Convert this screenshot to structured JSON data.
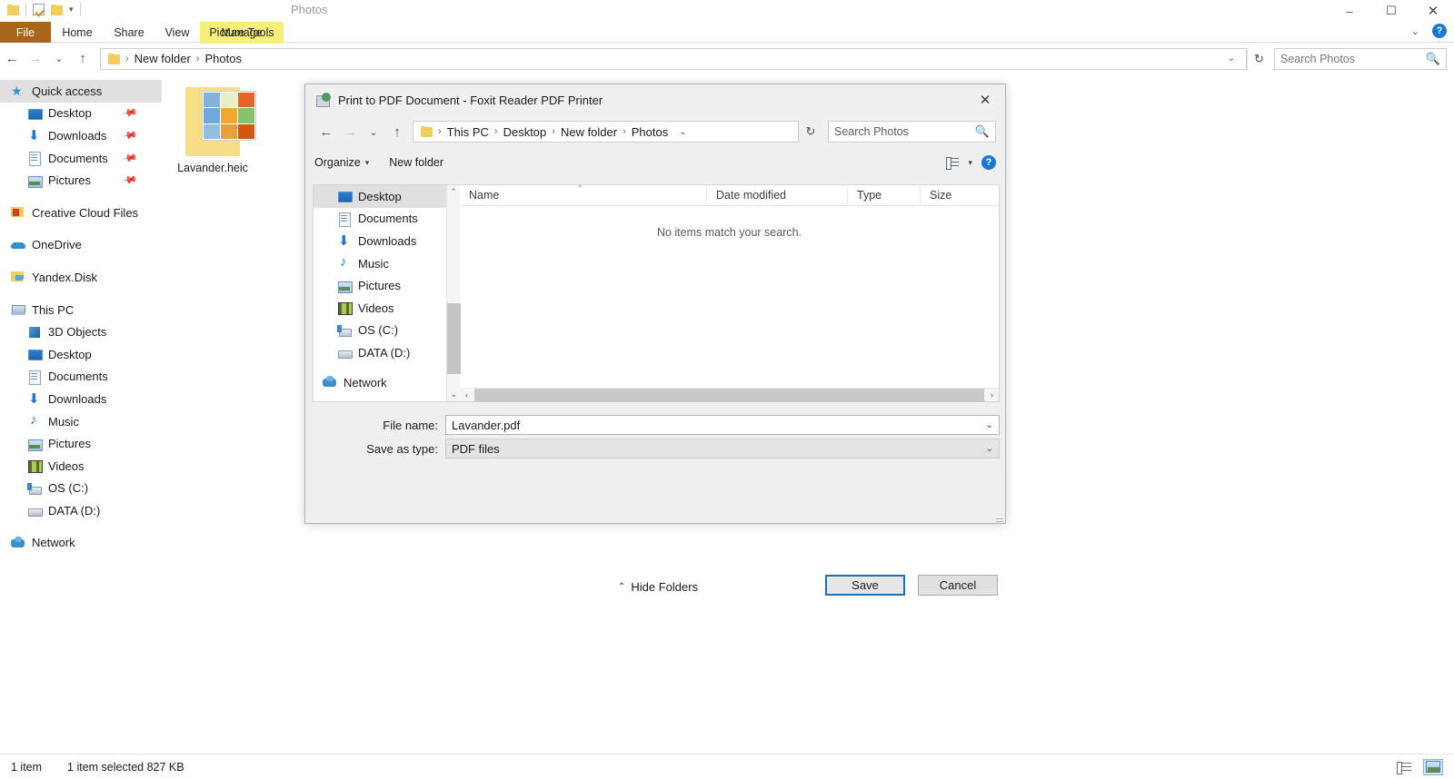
{
  "explorer": {
    "quick_access_toolbar": {
      "items": [
        "folder-icon",
        "checkbox-properties-icon",
        "folder-new-icon",
        "customize-caret-icon"
      ]
    },
    "window_controls": {
      "minimize": "–",
      "maximize": "❐",
      "close": "✕"
    },
    "ribbon": {
      "tabs": [
        "File",
        "Home",
        "Share",
        "View",
        "Picture Tools"
      ],
      "contextual_tab": "Manage",
      "app_label": "Photos",
      "collapse_caret": "⌄",
      "help_label": "?"
    },
    "address": {
      "back": "←",
      "forward": "→",
      "recent": "⌄",
      "up": "↑",
      "breadcrumbs": [
        "New folder",
        "Photos"
      ],
      "separator": "›",
      "dropdown_caret": "⌄",
      "refresh": "↻"
    },
    "search": {
      "placeholder": "Search Photos",
      "icon": "🔍"
    },
    "nav_pane": [
      {
        "label": "Quick access",
        "icon": "ic-star",
        "indent": "lvl0",
        "selected": true,
        "pinned": false
      },
      {
        "label": "Desktop",
        "icon": "ic-desktop",
        "indent": "lvl1",
        "selected": false,
        "pinned": true
      },
      {
        "label": "Downloads",
        "icon": "ic-download",
        "indent": "lvl1",
        "selected": false,
        "pinned": true
      },
      {
        "label": "Documents",
        "icon": "ic-doc",
        "indent": "lvl1",
        "selected": false,
        "pinned": true
      },
      {
        "label": "Pictures",
        "icon": "ic-pic",
        "indent": "lvl1",
        "selected": false,
        "pinned": true
      },
      {
        "label": "Creative Cloud Files",
        "icon": "ic-cc",
        "indent": "lvl0",
        "selected": false,
        "pinned": false
      },
      {
        "label": "OneDrive",
        "icon": "ic-cloud",
        "indent": "lvl0",
        "selected": false,
        "pinned": false
      },
      {
        "label": "Yandex.Disk",
        "icon": "ic-yandex",
        "indent": "lvl0",
        "selected": false,
        "pinned": false
      },
      {
        "label": "This PC",
        "icon": "ic-pc",
        "indent": "lvl0",
        "selected": false,
        "pinned": false
      },
      {
        "label": "3D Objects",
        "icon": "ic-3d",
        "indent": "lvl1",
        "selected": false,
        "pinned": false
      },
      {
        "label": "Desktop",
        "icon": "ic-desktop",
        "indent": "lvl1",
        "selected": false,
        "pinned": false
      },
      {
        "label": "Documents",
        "icon": "ic-doc",
        "indent": "lvl1",
        "selected": false,
        "pinned": false
      },
      {
        "label": "Downloads",
        "icon": "ic-download",
        "indent": "lvl1",
        "selected": false,
        "pinned": false
      },
      {
        "label": "Music",
        "icon": "ic-music",
        "indent": "lvl1",
        "selected": false,
        "pinned": false
      },
      {
        "label": "Pictures",
        "icon": "ic-pic",
        "indent": "lvl1",
        "selected": false,
        "pinned": false
      },
      {
        "label": "Videos",
        "icon": "ic-video",
        "indent": "lvl1",
        "selected": false,
        "pinned": false
      },
      {
        "label": "OS (C:)",
        "icon": "ic-osdrive",
        "indent": "lvl1",
        "selected": false,
        "pinned": false
      },
      {
        "label": "DATA (D:)",
        "icon": "ic-drive",
        "indent": "lvl1",
        "selected": false,
        "pinned": false
      },
      {
        "label": "Network",
        "icon": "ic-network",
        "indent": "lvl0",
        "selected": false,
        "pinned": false
      }
    ],
    "files": [
      {
        "name": "Lavander.heic",
        "thumb_colors": [
          "#7fb4d8",
          "#e8f0c8",
          "#e8632a",
          "#6fa8dc",
          "#f0a830",
          "#86c26a",
          "#8fc0e0",
          "#e8a03a",
          "#d4560f"
        ]
      }
    ],
    "status": {
      "count": "1 item",
      "selection": "1 item selected  827 KB"
    },
    "view_buttons": {
      "details": "details-view",
      "large_icons": "large-icons-view",
      "active": "large_icons"
    }
  },
  "dialog": {
    "title": "Print to PDF Document - Foxit Reader PDF Printer",
    "close": "✕",
    "nav": {
      "back": "←",
      "forward": "→",
      "recent": "⌄",
      "up": "↑",
      "breadcrumbs": [
        "This PC",
        "Desktop",
        "New folder",
        "Photos"
      ],
      "separator": "›",
      "dropdown_caret": "⌄",
      "refresh": "↻"
    },
    "search": {
      "placeholder": "Search Photos",
      "icon": "🔍"
    },
    "toolbar": {
      "organize": "Organize",
      "organize_caret": "▾",
      "new_folder": "New folder",
      "view_caret": "▾",
      "help_label": "?"
    },
    "tree": [
      {
        "label": "Desktop",
        "icon": "ic-desktop",
        "selected": true,
        "root": false
      },
      {
        "label": "Documents",
        "icon": "ic-doc",
        "selected": false,
        "root": false
      },
      {
        "label": "Downloads",
        "icon": "ic-download",
        "selected": false,
        "root": false
      },
      {
        "label": "Music",
        "icon": "ic-music",
        "selected": false,
        "root": false
      },
      {
        "label": "Pictures",
        "icon": "ic-pic",
        "selected": false,
        "root": false
      },
      {
        "label": "Videos",
        "icon": "ic-video",
        "selected": false,
        "root": false
      },
      {
        "label": "OS (C:)",
        "icon": "ic-osdrive",
        "selected": false,
        "root": false
      },
      {
        "label": "DATA (D:)",
        "icon": "ic-drive",
        "selected": false,
        "root": false
      },
      {
        "label": "Network",
        "icon": "ic-network",
        "selected": false,
        "root": true
      }
    ],
    "columns": [
      "Name",
      "Date modified",
      "Type",
      "Size"
    ],
    "sort_indicator": "⌃",
    "empty_message": "No items match your search.",
    "scroll": {
      "up": "⌃",
      "down": "⌄",
      "left": "‹",
      "right": "›"
    },
    "fields": {
      "file_name_label": "File name:",
      "file_name_value": "Lavander.pdf",
      "save_as_type_label": "Save as type:",
      "save_as_type_value": "PDF files",
      "caret": "⌄"
    },
    "hide_folders": {
      "label": "Hide Folders",
      "caret": "⌃"
    },
    "buttons": {
      "save": "Save",
      "cancel": "Cancel"
    }
  }
}
